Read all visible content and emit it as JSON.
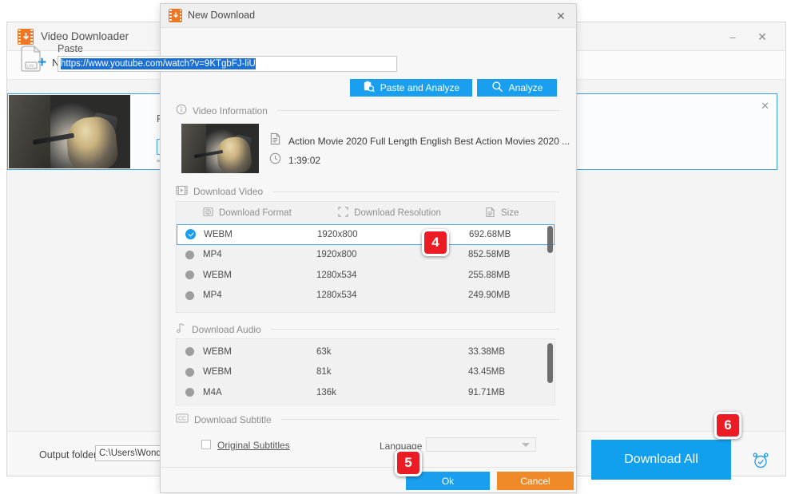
{
  "app": {
    "title": "Video Downloader",
    "logo_icon": "download-arrow-icon",
    "minimize_label": "–",
    "close_label": "✕",
    "toolbar": {
      "new_download_label": "New Download",
      "plus_icon": "plus-icon"
    },
    "card": {
      "file_label": "Fil",
      "close_label": "✕",
      "media_icon": "video-file-icon"
    },
    "footer": {
      "output_folder_label": "Output folder:",
      "output_folder_value": "C:\\Users\\WonderFox",
      "download_all_label": "Download All",
      "alarm_icon": "alarm-clock-icon"
    }
  },
  "dialog": {
    "title": "New Download",
    "icon": "download-arrow-icon",
    "close_label": "✕",
    "url": {
      "label": "Paste URL",
      "value": "https://www.youtube.com/watch?v=9KTgbFJ-liU",
      "icon": "paste-url-icon"
    },
    "buttons": {
      "paste_and_analyze": "Paste and Analyze",
      "paste_icon": "clipboard-search-icon",
      "analyze": "Analyze",
      "analyze_icon": "magnifier-icon"
    },
    "sections": {
      "video_information": "Video Information",
      "video_information_icon": "info-icon",
      "download_video": "Download Video",
      "download_video_icon": "film-strip-icon",
      "download_audio": "Download Audio",
      "download_audio_icon": "music-note-icon",
      "download_subtitle": "Download Subtitle",
      "download_subtitle_icon": "closed-caption-icon"
    },
    "video_info": {
      "title": "Action Movie 2020 Full Length English Best Action Movies 2020 ...",
      "title_icon": "document-icon",
      "duration": "1:39:02",
      "duration_icon": "clock-icon",
      "thumbnail_alt": "movie-thumbnail"
    },
    "video_table": {
      "columns": [
        "Download Format",
        "Download Resolution",
        "Size"
      ],
      "column_icons": [
        "video-format-icon",
        "resolution-frame-icon",
        "file-size-icon"
      ],
      "rows": [
        {
          "format": "WEBM",
          "resolution": "1920x800",
          "size": "692.68MB",
          "selected": true
        },
        {
          "format": "MP4",
          "resolution": "1920x800",
          "size": "852.58MB",
          "selected": false
        },
        {
          "format": "WEBM",
          "resolution": "1280x534",
          "size": "255.88MB",
          "selected": false
        },
        {
          "format": "MP4",
          "resolution": "1280x534",
          "size": "249.90MB",
          "selected": false
        }
      ]
    },
    "audio_table": {
      "rows": [
        {
          "format": "WEBM",
          "bitrate": "63k",
          "size": "33.38MB",
          "selected": false
        },
        {
          "format": "WEBM",
          "bitrate": "81k",
          "size": "43.45MB",
          "selected": false
        },
        {
          "format": "M4A",
          "bitrate": "136k",
          "size": "91.71MB",
          "selected": false
        }
      ]
    },
    "subtitle": {
      "original_subtitles_label": "Original Subtitles",
      "original_subtitles_checked": false,
      "language_label": "Language",
      "language_value": ""
    },
    "footer": {
      "ok_label": "Ok",
      "cancel_label": "Cancel"
    }
  },
  "badges": {
    "step4": "4",
    "step5": "5",
    "step6": "6"
  },
  "colors": {
    "accent_blue": "#1a9ff0",
    "orange": "#ef7622",
    "cancel_orange": "#f08a29",
    "badge_red": "#ec1c24",
    "selection_blue": "#1c6fd4"
  }
}
